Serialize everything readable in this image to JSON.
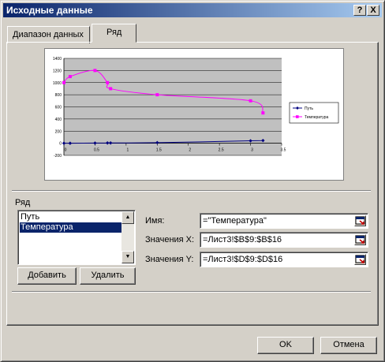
{
  "window": {
    "title": "Исходные данные",
    "help_label": "?",
    "close_label": "X"
  },
  "tabs": [
    {
      "label": "Диапазон данных",
      "active": false
    },
    {
      "label": "Ряд",
      "active": true
    }
  ],
  "series_section": {
    "label": "Ряд",
    "items": [
      "Путь",
      "Температура"
    ],
    "selected_index": 1,
    "add_button": "Добавить",
    "remove_button": "Удалить"
  },
  "fields": {
    "name_label": "Имя:",
    "name_value": "=\"Температура\"",
    "x_label": "Значения X:",
    "x_value": "=Лист3!$B$9:$B$16",
    "y_label": "Значения Y:",
    "y_value": "=Лист3!$D$9:$D$16"
  },
  "buttons": {
    "ok": "OK",
    "cancel": "Отмена"
  },
  "chart_data": {
    "type": "scatter",
    "xlim": [
      0,
      3.5
    ],
    "ylim": [
      -200,
      1400
    ],
    "x_ticks": [
      "0",
      "0.5",
      "1",
      "1.5",
      "2",
      "2.5",
      "3",
      "3.5"
    ],
    "y_ticks": [
      "-200",
      "0",
      "200",
      "400",
      "600",
      "800",
      "1000",
      "1200",
      "1400"
    ],
    "plot_background": "#c0c0c0",
    "legend_position": "right",
    "series": [
      {
        "name": "Путь",
        "color": "#000080",
        "marker": "diamond",
        "x": [
          0,
          0.1,
          0.5,
          0.7,
          0.75,
          1.5,
          3.0,
          3.2
        ],
        "y": [
          0,
          0,
          3,
          5,
          5,
          10,
          40,
          45
        ]
      },
      {
        "name": "Температура",
        "color": "#ff00ff",
        "marker": "square",
        "x": [
          0,
          0.1,
          0.5,
          0.7,
          0.75,
          1.5,
          3.0,
          3.2
        ],
        "y": [
          1000,
          1100,
          1200,
          1000,
          900,
          800,
          700,
          500
        ]
      }
    ]
  }
}
